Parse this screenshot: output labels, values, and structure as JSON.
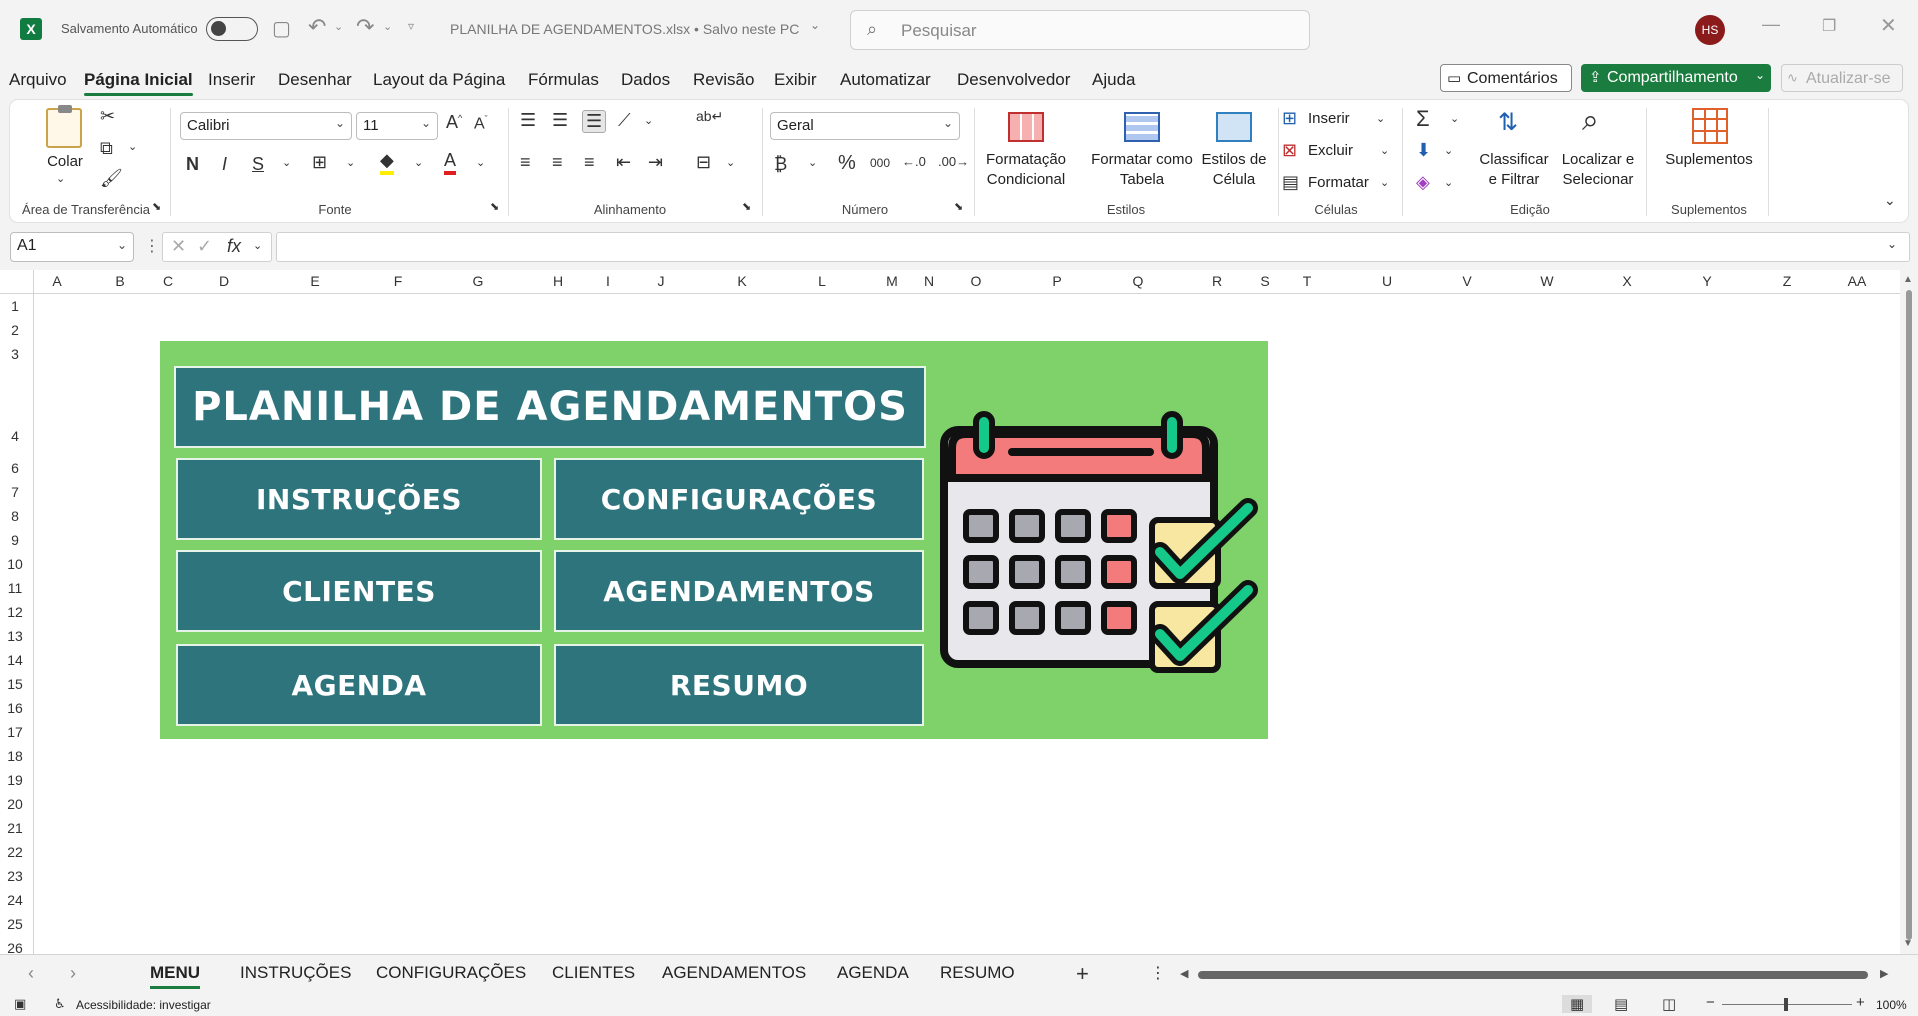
{
  "titlebar": {
    "autosave_label": "Salvamento Automático",
    "file_title": "PLANILHA DE AGENDAMENTOS.xlsx • Salvo neste PC",
    "search_placeholder": "Pesquisar",
    "avatar_initials": "HS"
  },
  "menu": {
    "items": [
      "Arquivo",
      "Página Inicial",
      "Inserir",
      "Desenhar",
      "Layout da Página",
      "Fórmulas",
      "Dados",
      "Revisão",
      "Exibir",
      "Automatizar",
      "Desenvolvedor",
      "Ajuda"
    ],
    "active": "Página Inicial",
    "comments_label": "Comentários",
    "share_label": "Compartilhamento",
    "update_label": "Atualizar-se"
  },
  "ribbon": {
    "clipboard": {
      "paste_label": "Colar",
      "group_label": "Área de Transferência"
    },
    "font": {
      "font_name": "Calibri",
      "font_size": "11",
      "group_label": "Fonte"
    },
    "alignment": {
      "group_label": "Alinhamento"
    },
    "number": {
      "format": "Geral",
      "group_label": "Número"
    },
    "styles": {
      "conditional_line1": "Formatação",
      "conditional_line2": "Condicional",
      "table_line1": "Formatar como",
      "table_line2": "Tabela",
      "cell_line1": "Estilos de",
      "cell_line2": "Célula",
      "group_label": "Estilos"
    },
    "cells": {
      "insert": "Inserir",
      "delete": "Excluir",
      "format": "Formatar",
      "group_label": "Células"
    },
    "editing": {
      "sort_line1": "Classificar",
      "sort_line2": "e Filtrar",
      "find_line1": "Localizar e",
      "find_line2": "Selecionar",
      "group_label": "Edição"
    },
    "addins": {
      "label": "Suplementos",
      "group_label": "Suplementos"
    }
  },
  "formula_bar": {
    "name_box": "A1",
    "formula": ""
  },
  "columns": [
    "A",
    "B",
    "C",
    "D",
    "E",
    "F",
    "G",
    "H",
    "I",
    "J",
    "K",
    "L",
    "M",
    "N",
    "O",
    "P",
    "Q",
    "R",
    "S",
    "T",
    "U",
    "V",
    "W",
    "X",
    "Y",
    "Z",
    "AA"
  ],
  "rows": [
    "1",
    "2",
    "3",
    "4",
    "6",
    "7",
    "8",
    "9",
    "10",
    "11",
    "12",
    "13",
    "14",
    "15",
    "16",
    "17",
    "18",
    "19",
    "20",
    "21",
    "22",
    "23",
    "24",
    "25",
    "26"
  ],
  "dashboard": {
    "title": "PLANILHA DE AGENDAMENTOS",
    "buttons": [
      "INSTRUÇÕES",
      "CONFIGURAÇÕES",
      "CLIENTES",
      "AGENDAMENTOS",
      "AGENDA",
      "RESUMO"
    ],
    "colors": {
      "background": "#7fd16a",
      "button": "#2e747d",
      "text": "#ffffff"
    }
  },
  "sheets": {
    "tabs": [
      "MENU",
      "INSTRUÇÕES",
      "CONFIGURAÇÕES",
      "CLIENTES",
      "AGENDAMENTOS",
      "AGENDA",
      "RESUMO"
    ],
    "active": "MENU"
  },
  "status": {
    "accessibility": "Acessibilidade: investigar",
    "zoom": "100%"
  },
  "colors": {
    "accent": "#1a7c3e",
    "excel_green": "#107c41"
  }
}
